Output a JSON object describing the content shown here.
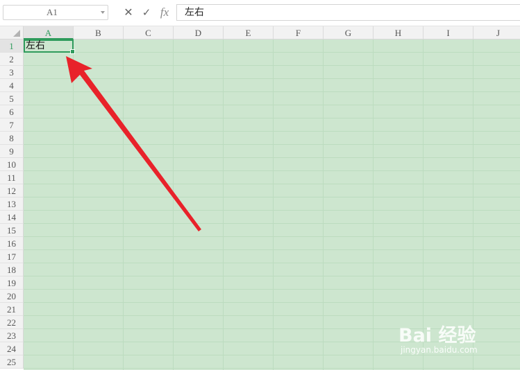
{
  "formula_bar": {
    "name_box": "A1",
    "cancel_glyph": "✕",
    "confirm_glyph": "✓",
    "fx_label": "fx",
    "content": "左右"
  },
  "columns": [
    "A",
    "B",
    "C",
    "D",
    "E",
    "F",
    "G",
    "H",
    "I",
    "J"
  ],
  "rows": [
    "1",
    "2",
    "3",
    "4",
    "5",
    "6",
    "7",
    "8",
    "9",
    "10",
    "11",
    "12",
    "13",
    "14",
    "15",
    "16",
    "17",
    "18",
    "19",
    "20",
    "21",
    "22",
    "23",
    "24",
    "25"
  ],
  "active_cell": {
    "ref": "A1",
    "value": "左右"
  },
  "colors": {
    "sheet_background": "#cde6cf",
    "selection": "#2f9b5c",
    "arrow": "#e8222a"
  },
  "watermark": {
    "brand": "Bai 经验",
    "url": "jingyan.baidu.com"
  }
}
